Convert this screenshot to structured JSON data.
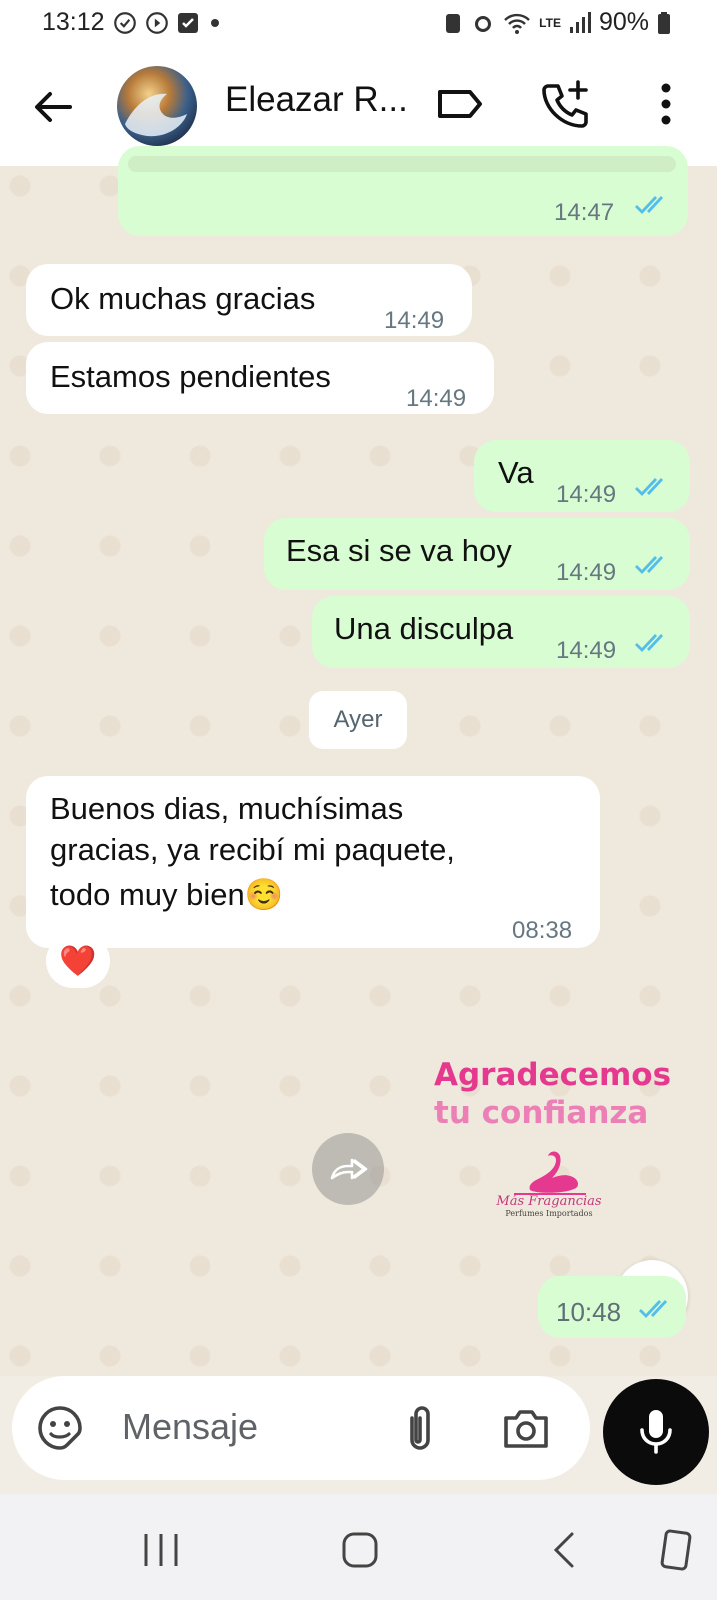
{
  "status_bar": {
    "time": "13:12",
    "battery": "90%",
    "network": "LTE"
  },
  "header": {
    "contact_name": "Eleazar R..."
  },
  "chat": {
    "messages": [
      {
        "dir": "out",
        "time": "14:47",
        "text": ""
      },
      {
        "dir": "in",
        "text": "Ok muchas gracias",
        "time": "14:49"
      },
      {
        "dir": "in",
        "text": "Estamos pendientes",
        "time": "14:49"
      },
      {
        "dir": "out",
        "text": "Va",
        "time": "14:49"
      },
      {
        "dir": "out",
        "text": "Esa si se va hoy",
        "time": "14:49"
      },
      {
        "dir": "out",
        "text": "Una disculpa",
        "time": "14:49"
      },
      {
        "dir": "in",
        "text_lines": [
          "Buenos dias, muchísimas",
          "gracias, ya recibí mi paquete,",
          "todo muy bien☺️"
        ],
        "time": "08:38",
        "reaction": "❤️"
      },
      {
        "dir": "out",
        "type": "image",
        "time": "10:48",
        "image_text": {
          "line1": "Agradecemos",
          "line2": "tu confianza",
          "brand": "Más Fragancias",
          "brand_sub": "Perfumes Importados"
        }
      }
    ],
    "day_separator": "Ayer"
  },
  "input": {
    "placeholder": "Mensaje"
  },
  "colors": {
    "outgoing": "#d9fdd3",
    "incoming": "#ffffff",
    "ticks": "#53bdeb",
    "accent": "#e5388f"
  }
}
